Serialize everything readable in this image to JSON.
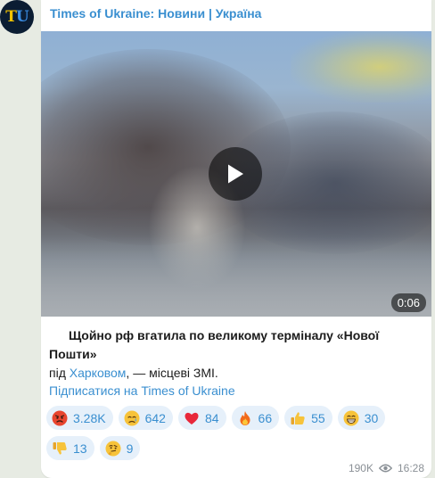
{
  "channel": {
    "avatar_letter_1": "T",
    "avatar_letter_2": "U",
    "name": "Times of Ukraine: Новини | Україна"
  },
  "video": {
    "duration": "0:06"
  },
  "caption": {
    "bold_text": "Щойно рф вгатила по великому терміналу «Нової Пошти»",
    "prefix": "під ",
    "link_text": "Харковом",
    "suffix": ", — місцеві ЗМІ."
  },
  "subscribe_link": "Підписатися на Times of Ukraine",
  "reactions": [
    {
      "icon": "angry-face",
      "count": "3.28K"
    },
    {
      "icon": "crying-face",
      "count": "642"
    },
    {
      "icon": "red-heart",
      "count": "84"
    },
    {
      "icon": "fire",
      "count": "66"
    },
    {
      "icon": "thumbs-up",
      "count": "55"
    },
    {
      "icon": "grinning-face",
      "count": "30"
    },
    {
      "icon": "thumbs-down",
      "count": "13"
    },
    {
      "icon": "thinking-face",
      "count": "9"
    }
  ],
  "footer": {
    "views": "190K",
    "time": "16:28"
  },
  "colors": {
    "accent": "#3a8fd0",
    "background": "#e7ebe3",
    "reaction_bg": "#e6f0fa"
  }
}
